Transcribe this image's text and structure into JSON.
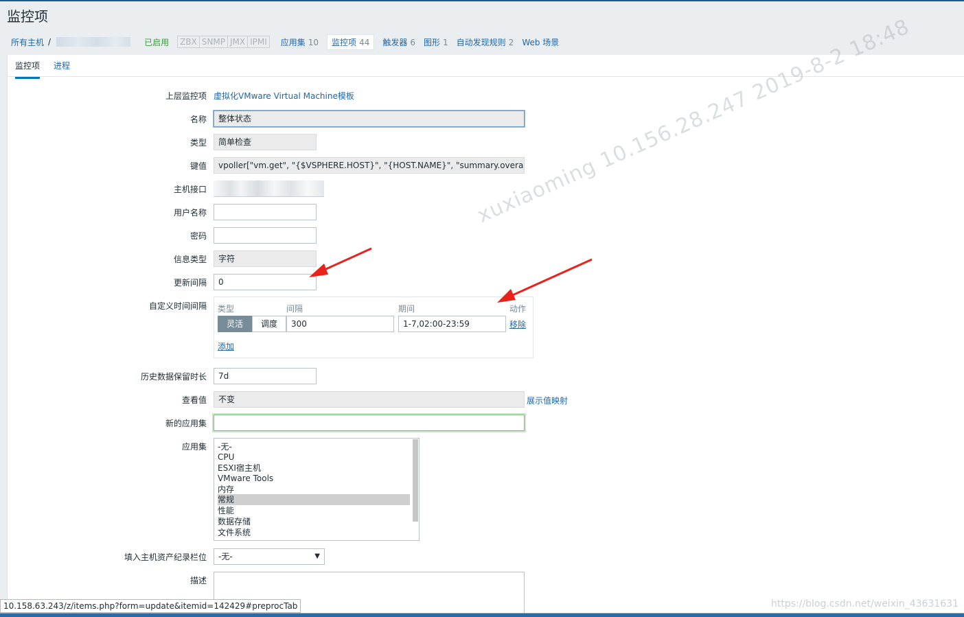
{
  "page": {
    "title": "监控项"
  },
  "breadcrumbs": {
    "all_hosts": "所有主机",
    "separator": "/",
    "enabled": "已启用",
    "protocols": [
      "ZBX",
      "SNMP",
      "JMX",
      "IPMI"
    ],
    "links": [
      {
        "label": "应用集",
        "count": "10"
      },
      {
        "label": "监控项",
        "count": "44",
        "active": true
      },
      {
        "label": "触发器",
        "count": "6"
      },
      {
        "label": "图形",
        "count": "1"
      },
      {
        "label": "自动发现规则",
        "count": "2"
      },
      {
        "label": "Web 场景",
        "count": ""
      }
    ]
  },
  "tabs": [
    "监控项",
    "进程"
  ],
  "form": {
    "parent_label": "上层监控项",
    "parent_value": "虚拟化VMware Virtual Machine模板",
    "name_label": "名称",
    "name_value": "整体状态",
    "type_label": "类型",
    "type_value": "简单检查",
    "key_label": "键值",
    "key_value": "vpoller[\"vm.get\", \"{$VSPHERE.HOST}\", \"{HOST.NAME}\", \"summary.overallStatus\",",
    "iface_label": "主机接口",
    "user_label": "用户名称",
    "user_value": "",
    "password_label": "密码",
    "password_value": "",
    "info_type_label": "信息类型",
    "info_type_value": "字符",
    "update_label": "更新间隔",
    "update_value": "0",
    "custom_label": "自定义时间间隔",
    "custom": {
      "hdr_type": "类型",
      "hdr_interval": "间隔",
      "hdr_period": "期间",
      "hdr_action": "动作",
      "flexible": "灵活",
      "scheduling": "调度",
      "interval_value": "300",
      "period_value": "1-7,02:00-23:59",
      "remove": "移除",
      "add": "添加"
    },
    "history_label": "历史数据保留时长",
    "history_value": "7d",
    "valuemap_label": "查看值",
    "valuemap_value": "不变",
    "valuemap_link": "展示值映射",
    "new_app_label": "新的应用集",
    "new_app_value": "",
    "apps_label": "应用集",
    "apps": [
      "-无-",
      "CPU",
      "ESXI宿主机",
      "VMware Tools",
      "内存",
      "常规",
      "性能",
      "数据存储",
      "文件系统"
    ],
    "apps_selected_index": 5,
    "inventory_label": "填入主机资产纪录栏位",
    "inventory_value": "-无-",
    "desc_label": "描述"
  },
  "watermark": "xuxiaoming   10.156.28.247   2019-8-2 18:48",
  "status_url": "10.158.63.243/z/items.php?form=update&itemid=142429#preprocTab",
  "csdn": "https://blog.csdn.net/weixin_43631631",
  "colors": {
    "link": "#1f65a8",
    "enabled": "#3d9a3d",
    "arrow": "#e8231c",
    "tab_active": "#0275b8"
  }
}
